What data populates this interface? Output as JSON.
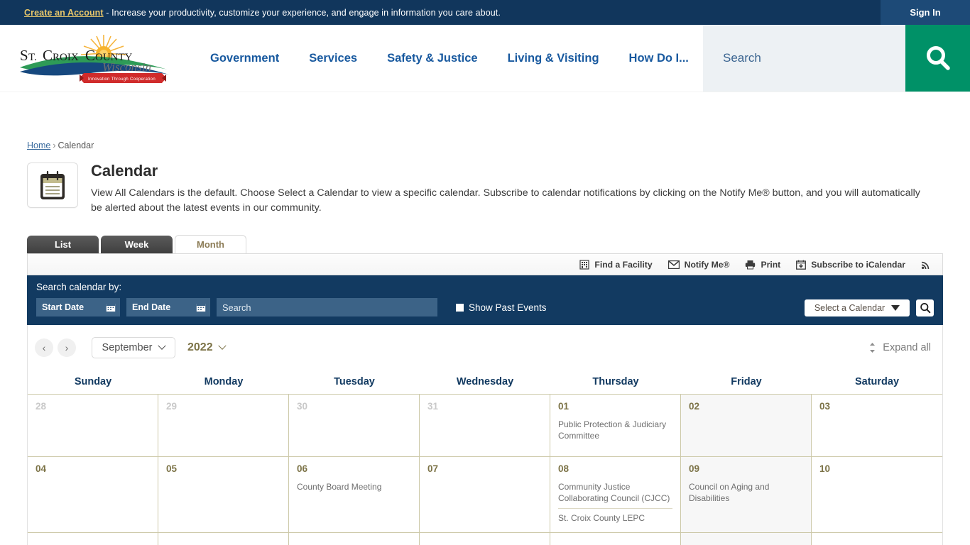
{
  "topbar": {
    "create_account": "Create an Account",
    "message": " - Increase your productivity, customize your experience, and engage in information you care about.",
    "signin": "Sign In"
  },
  "header": {
    "logo_line1": "St. Croix County",
    "logo_line2": "Wisconsin",
    "logo_ribbon": "Innovation Through Cooperation",
    "nav": [
      {
        "label": "Government"
      },
      {
        "label": "Services"
      },
      {
        "label": "Safety & Justice"
      },
      {
        "label": "Living & Visiting"
      },
      {
        "label": "How Do I..."
      }
    ],
    "search_placeholder": "Search",
    "search_value": ""
  },
  "breadcrumb": {
    "home": "Home",
    "separator": "›",
    "current": "Calendar"
  },
  "page": {
    "title": "Calendar",
    "description": "View All Calendars is the default. Choose Select a Calendar to view a specific calendar. Subscribe to calendar notifications by clicking on the Notify Me® button, and you will automatically be alerted about the latest events in our community."
  },
  "tabs": [
    {
      "label": "List",
      "active": false
    },
    {
      "label": "Week",
      "active": false
    },
    {
      "label": "Month",
      "active": true
    }
  ],
  "tools": [
    {
      "label": "Find a Facility",
      "icon": "building-icon"
    },
    {
      "label": "Notify Me®",
      "icon": "envelope-icon"
    },
    {
      "label": "Print",
      "icon": "printer-icon"
    },
    {
      "label": "Subscribe to iCalendar",
      "icon": "calendar-download-icon"
    },
    {
      "label": "",
      "icon": "rss-icon"
    }
  ],
  "calsearch": {
    "label": "Search calendar by:",
    "start_date_placeholder": "Start Date",
    "start_date_value": "",
    "end_date_placeholder": "End Date",
    "end_date_value": "",
    "search_placeholder": "Search",
    "search_value": "",
    "show_past_events": "Show Past Events",
    "show_past_events_checked": false,
    "select_calendar": "Select a Calendar"
  },
  "monthnav": {
    "prev": "‹",
    "next": "›",
    "month": "September",
    "year": "2022",
    "expand_all": "Expand all"
  },
  "calendar": {
    "day_headers": [
      "Sunday",
      "Monday",
      "Tuesday",
      "Wednesday",
      "Thursday",
      "Friday",
      "Saturday"
    ],
    "weeks": [
      {
        "days": [
          {
            "num": "28",
            "out_of_month": true,
            "shaded": false,
            "events": []
          },
          {
            "num": "29",
            "out_of_month": true,
            "shaded": false,
            "events": []
          },
          {
            "num": "30",
            "out_of_month": true,
            "shaded": false,
            "events": []
          },
          {
            "num": "31",
            "out_of_month": true,
            "shaded": false,
            "events": []
          },
          {
            "num": "01",
            "out_of_month": false,
            "shaded": false,
            "events": [
              "Public Protection & Judiciary Committee"
            ]
          },
          {
            "num": "02",
            "out_of_month": false,
            "shaded": true,
            "events": []
          },
          {
            "num": "03",
            "out_of_month": false,
            "shaded": false,
            "events": []
          }
        ]
      },
      {
        "days": [
          {
            "num": "04",
            "out_of_month": false,
            "shaded": false,
            "events": []
          },
          {
            "num": "05",
            "out_of_month": false,
            "shaded": false,
            "events": []
          },
          {
            "num": "06",
            "out_of_month": false,
            "shaded": false,
            "events": [
              "County Board Meeting"
            ]
          },
          {
            "num": "07",
            "out_of_month": false,
            "shaded": false,
            "events": []
          },
          {
            "num": "08",
            "out_of_month": false,
            "shaded": false,
            "events": [
              "Community Justice Collaborating Council (CJCC)",
              "St. Croix County LEPC"
            ]
          },
          {
            "num": "09",
            "out_of_month": false,
            "shaded": true,
            "events": [
              "Council on Aging and Disabilities"
            ]
          },
          {
            "num": "10",
            "out_of_month": false,
            "shaded": false,
            "events": []
          }
        ]
      },
      {
        "partial": true,
        "days": [
          {
            "num": "",
            "out_of_month": false,
            "shaded": false,
            "events": []
          },
          {
            "num": "",
            "out_of_month": false,
            "shaded": false,
            "events": []
          },
          {
            "num": "",
            "out_of_month": false,
            "shaded": false,
            "events": []
          },
          {
            "num": "",
            "out_of_month": false,
            "shaded": false,
            "events": []
          },
          {
            "num": "",
            "out_of_month": false,
            "shaded": false,
            "events": []
          },
          {
            "num": "",
            "out_of_month": false,
            "shaded": true,
            "events": []
          },
          {
            "num": "",
            "out_of_month": false,
            "shaded": false,
            "events": []
          }
        ]
      }
    ]
  }
}
